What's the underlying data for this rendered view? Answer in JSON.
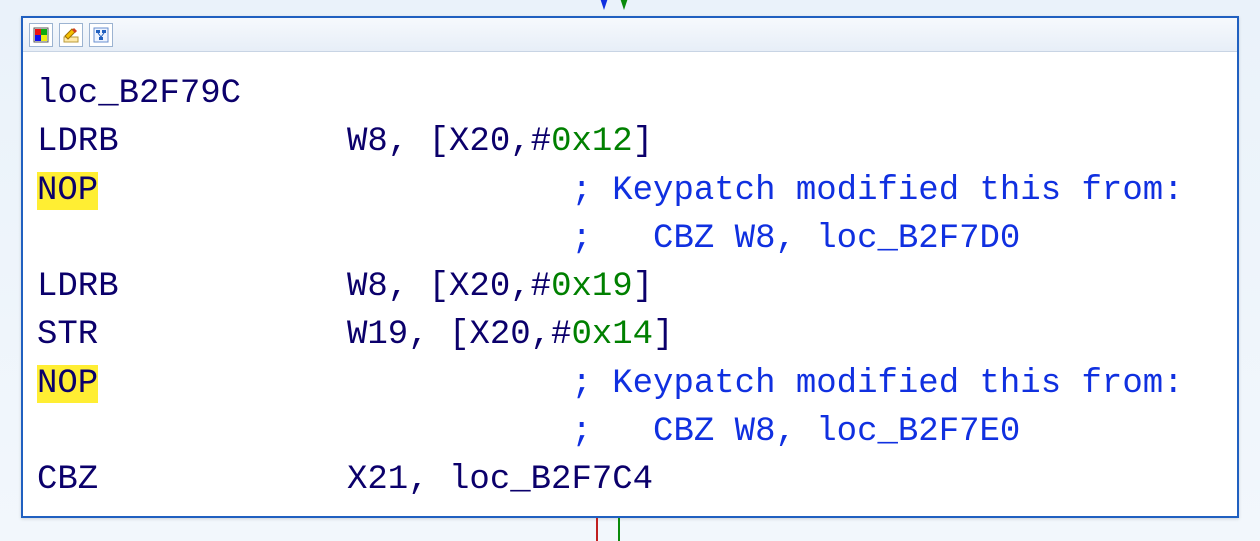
{
  "arrows": {
    "in": [
      "blue",
      "green"
    ],
    "out": [
      "red",
      "green"
    ]
  },
  "toolbar": {
    "btn1": "color-icon",
    "btn2": "edit-icon",
    "btn3": "graph-icon"
  },
  "block_label": "loc_B2F79C",
  "lines": [
    {
      "mnemonic": "LDRB",
      "ops_reg1": "W8",
      "ops_punct1": ", [",
      "ops_reg2": "X20",
      "ops_punct2": ",#",
      "ops_imm": "0x12",
      "ops_punct3": "]",
      "comment": ""
    },
    {
      "mnemonic": "NOP",
      "mnemonic_hl": true,
      "comment": "; Keypatch modified this from:"
    },
    {
      "mnemonic": "",
      "comment": ";   CBZ W8, loc_B2F7D0"
    },
    {
      "mnemonic": "LDRB",
      "ops_reg1": "W8",
      "ops_punct1": ", [",
      "ops_reg2": "X20",
      "ops_punct2": ",#",
      "ops_imm": "0x19",
      "ops_punct3": "]",
      "comment": ""
    },
    {
      "mnemonic": "STR",
      "ops_reg1": "W19",
      "ops_punct1": ", [",
      "ops_reg2": "X20",
      "ops_punct2": ",#",
      "ops_imm": "0x14",
      "ops_punct3": "]",
      "comment": ""
    },
    {
      "mnemonic": "NOP",
      "mnemonic_hl": true,
      "comment": "; Keypatch modified this from:"
    },
    {
      "mnemonic": "",
      "comment": ";   CBZ W8, loc_B2F7E0"
    },
    {
      "mnemonic": "CBZ",
      "ops_reg1": "X21",
      "ops_punct1": ", ",
      "ops_label": "loc_B2F7C4",
      "comment": ""
    }
  ]
}
